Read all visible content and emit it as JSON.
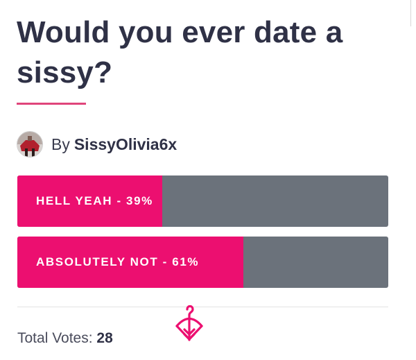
{
  "poll": {
    "question": "Would you ever date a sissy?",
    "author_prefix": "By",
    "author_name": "SissyOlivia6x",
    "options": [
      {
        "text": "HELL YEAH - 39%",
        "percent": 39
      },
      {
        "text": "ABSOLUTELY NOT - 61%",
        "percent": 61
      }
    ],
    "total_label": "Total Votes:",
    "total_count": "28"
  },
  "colors": {
    "title": "#2f3146",
    "accent": "#e0457b",
    "bar_fill": "#ec0f70",
    "bar_track": "#6b727b"
  },
  "icons": {
    "logo": "bow-and-arrow-logo-icon",
    "avatar": "user-avatar"
  }
}
